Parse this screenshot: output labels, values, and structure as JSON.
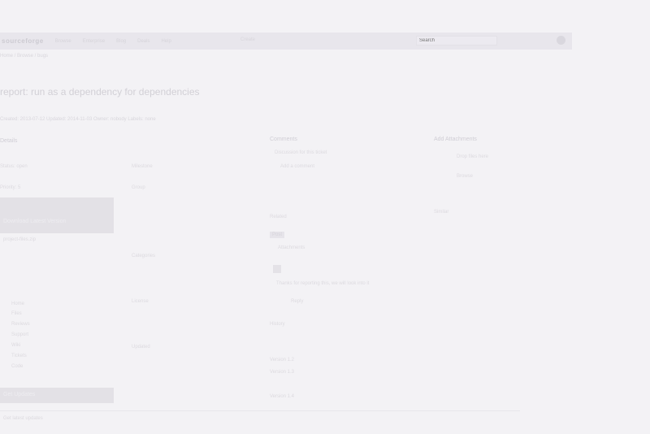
{
  "topbar": {
    "brand": "sourceforge",
    "nav": [
      "Browse",
      "Enterprise",
      "Blog",
      "Deals",
      "Help"
    ],
    "center_text": "Create",
    "search_placeholder": "Search",
    "user_icon": "user-icon"
  },
  "breadcrumb": "Home / Browse / bugs",
  "page": {
    "title": "report: run as a dependency for dependencies",
    "subtitle": "Created: 2013-07-12 Updated: 2014-11-03 Owner: nobody Labels: none"
  },
  "left_col": {
    "header": "Details",
    "fields": [
      {
        "label": "Status: open",
        "value": "Milestone"
      },
      {
        "label": "Priority: 5",
        "value": "Group"
      }
    ],
    "box1_title": "Download Latest Version",
    "box1_sub": "project-files.zip",
    "links": [
      "Home",
      "Files",
      "Reviews",
      "Support",
      "Wiki",
      "Tickets",
      "Code"
    ],
    "mid_items": [
      "Categories",
      "License",
      "Updated"
    ],
    "box2_title": "Get Updates"
  },
  "center_col": {
    "header": "Comments",
    "line1": "Discussion for this ticket",
    "line2": "Add a comment",
    "section2": "Related",
    "button": "Post",
    "attach": "Attachments",
    "comment1": "Thanks for reporting this, we will look into it",
    "comment2": "Reply",
    "section3": "History",
    "items": [
      "Version 1.2",
      "Version 1.3",
      "Version 1.4"
    ]
  },
  "right_col": {
    "header": "Add Attachments",
    "line1": "Drop files here",
    "line2": "Browse",
    "section2": "Similar"
  },
  "footer": "Get latest updates"
}
